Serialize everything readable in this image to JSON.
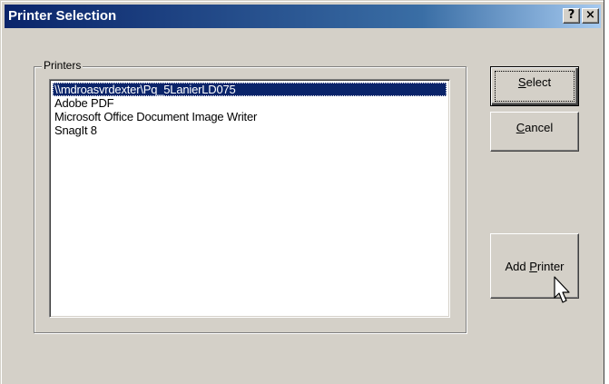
{
  "window": {
    "title": "Printer Selection",
    "help_glyph": "?",
    "close_glyph": "×"
  },
  "printers_group": {
    "label": "Printers",
    "items": [
      {
        "label": "\\\\mdroasvrdexter\\Pq_5LanierLD075",
        "selected": true
      },
      {
        "label": "Adobe PDF",
        "selected": false
      },
      {
        "label": "Microsoft Office Document Image Writer",
        "selected": false
      },
      {
        "label": "SnagIt 8",
        "selected": false
      }
    ]
  },
  "buttons": {
    "select": {
      "mnemonic": "S",
      "rest": "elect"
    },
    "cancel": {
      "mnemonic": "C",
      "rest": "ancel"
    },
    "add_printer": {
      "prefix": "Add ",
      "mnemonic": "P",
      "rest": "rinter"
    }
  },
  "colors": {
    "title_start": "#0a246a",
    "title_end": "#a6caf0",
    "selection": "#0a246a",
    "face": "#d4d0c8"
  },
  "icons": {
    "cursor": "arrow-cursor-icon"
  }
}
